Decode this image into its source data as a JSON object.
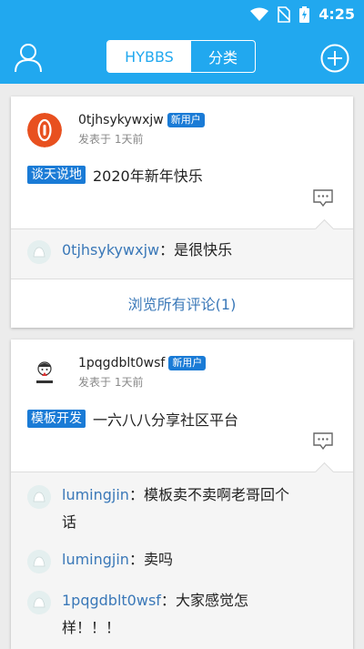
{
  "status_bar": {
    "time": "4:25"
  },
  "header": {
    "tabs": [
      {
        "label": "HYBBS",
        "active": true
      },
      {
        "label": "分类",
        "active": false
      }
    ],
    "accent_color": "#21a8ef"
  },
  "posts": [
    {
      "author": "0tjhsykywxjw",
      "badge": "新用户",
      "time": "发表于 1天前",
      "tag": "谈天说地",
      "text": "2020年新年快乐",
      "comments": [
        {
          "name": "0tjhsykywxjw",
          "separator": "：",
          "text": "是很快乐"
        }
      ],
      "view_all": "浏览所有评论(1)"
    },
    {
      "author": "1pqgdblt0wsf",
      "badge": "新用户",
      "time": "发表于 1天前",
      "tag": "模板开发",
      "text": "一六八八分享社区平台",
      "comments": [
        {
          "name": "lumingjin",
          "separator": "：",
          "text": "模板卖不卖啊老哥回个",
          "text2": "话"
        },
        {
          "name": "lumingjin",
          "separator": "：",
          "text": "卖吗"
        },
        {
          "name": "1pqgdblt0wsf",
          "separator": "：",
          "text": "大家感觉怎",
          "text2": "样！！！"
        }
      ]
    }
  ]
}
